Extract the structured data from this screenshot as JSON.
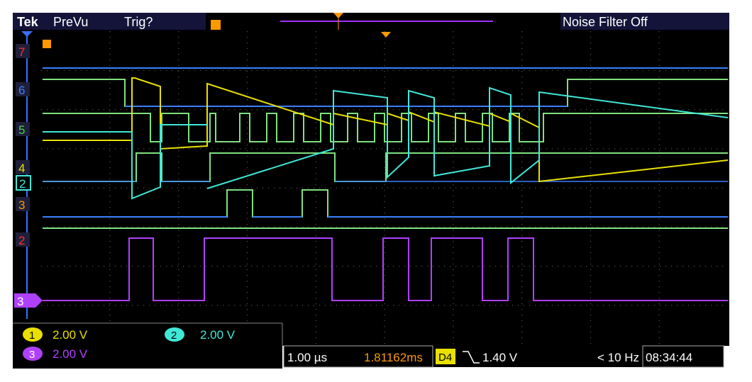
{
  "header": {
    "brand": "Tek",
    "mode": "PreVu",
    "trigger_status": "Trig?",
    "noise_filter": "Noise Filter Off"
  },
  "colors": {
    "background": "#000000",
    "panel_blue": "#1f1f3a",
    "ch1": "#e9e000",
    "ch2": "#40e8d8",
    "ch3": "#b040ff",
    "ch4": "#40d840",
    "digital_high": "#7fe07f",
    "digital_low": "#3a7fff",
    "trigger_marker": "#ff9900"
  },
  "digital_labels": [
    "7",
    "6",
    "5",
    "4",
    "3"
  ],
  "ref_labels": {
    "ch2_marker": "2",
    "ch3_marker": "3",
    "ch2_side": "2"
  },
  "channels": {
    "ch1": {
      "index": "1",
      "scale": "2.00 V"
    },
    "ch2": {
      "index": "2",
      "scale": "2.00 V"
    },
    "ch3": {
      "index": "3",
      "scale": "2.00 V"
    }
  },
  "status": {
    "timebase": "1.00 µs",
    "position": "1.81162ms",
    "trigger_source": "D4",
    "trigger_level": "1.40 V",
    "frequency": "< 10 Hz",
    "time": "08:34:44"
  },
  "icons": {
    "trigger_marker": "trigger-arrow-icon",
    "edge": "falling-edge-icon"
  }
}
